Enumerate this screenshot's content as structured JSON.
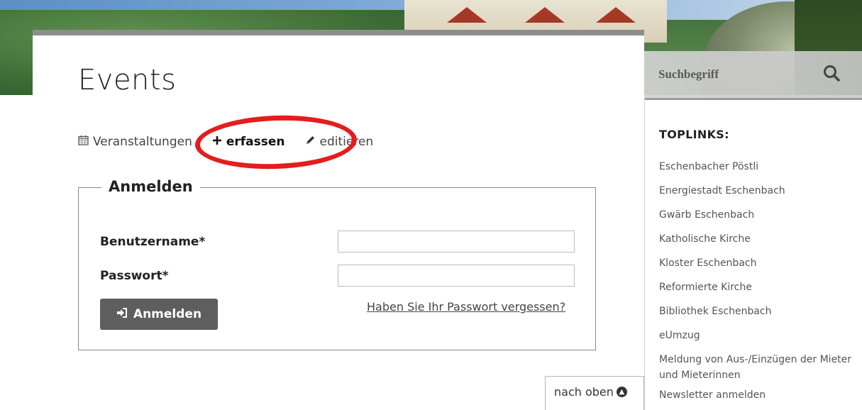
{
  "page": {
    "title": "Events"
  },
  "subnav": {
    "items": [
      {
        "icon": "calendar-icon",
        "label": "Veranstaltungen"
      },
      {
        "icon": "plus-icon",
        "label": "erfassen"
      },
      {
        "icon": "pencil-icon",
        "label": "editieren"
      }
    ]
  },
  "login": {
    "legend": "Anmelden",
    "username_label": "Benutzername*",
    "username_value": "",
    "password_label": "Passwort*",
    "password_value": "",
    "submit_label": "Anmelden",
    "forgot_label": "Haben Sie Ihr Passwort vergessen?"
  },
  "back_to_top": {
    "label": "nach oben"
  },
  "search": {
    "placeholder": "Suchbegriff"
  },
  "sidebar": {
    "heading": "TOPLINKS:",
    "links": [
      "Eschenbacher Pöstli",
      "Energiestadt Eschenbach",
      "Gwärb Eschenbach",
      "Katholische Kirche",
      "Kloster Eschenbach",
      "Reformierte Kirche",
      "Bibliothek Eschenbach",
      "eUmzug",
      "Meldung von Aus-/Einzügen der Mieter und Mieterinnen",
      "Newsletter anmelden"
    ]
  },
  "colors": {
    "highlight": "#e41d1d",
    "button_bg": "#5e5e5e",
    "text": "#222222"
  }
}
